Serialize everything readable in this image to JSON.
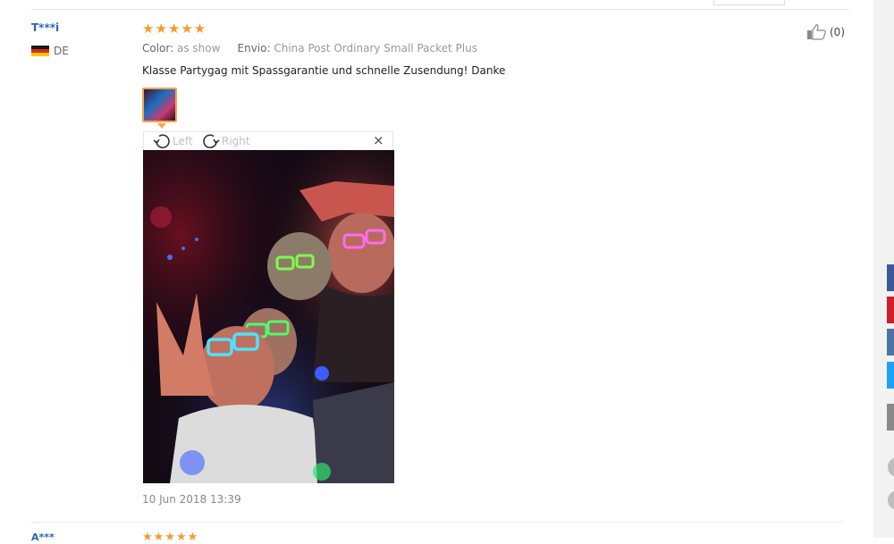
{
  "review": {
    "user_name": "T***i",
    "country": "DE",
    "stars": "★★★★★",
    "color_label": "Color:",
    "color_value": "as show",
    "shipping_label": "Envio:",
    "shipping_value": "China Post Ordinary Small Packet Plus",
    "text": "Klasse Partygag mit Spassgarantie und schnelle Zusendung! Danke",
    "date": "10 Jun 2018 13:39",
    "helpful_count": "(0)"
  },
  "viewer": {
    "rotate_left_label": "Left",
    "rotate_right_label": "Right",
    "close_label": "×"
  },
  "next_review": {
    "user_name": "A***",
    "stars": "★★★★★"
  },
  "colors": {
    "star": "#f79a2d",
    "user_name": "#2a66b0",
    "thumb_border": "#f7a54a",
    "share_facebook": "#3b5998",
    "share_pinterest": "#cb2027",
    "share_vk": "#4c75a3",
    "share_twitter": "#1da1f2",
    "share_other": "#8a8a8a"
  }
}
